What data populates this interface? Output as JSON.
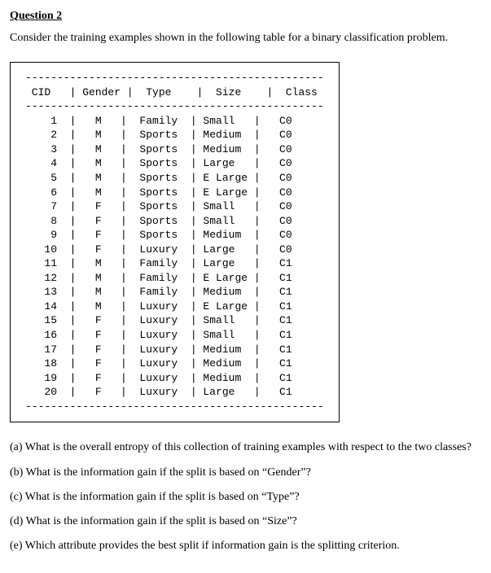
{
  "header": "Question 2",
  "problem": "Consider the training examples shown in the following table for a binary classification problem.",
  "table": {
    "columns": [
      "CID",
      "Gender",
      "Type",
      "Size",
      "Class"
    ],
    "rows": [
      {
        "cid": "1",
        "gender": "M",
        "type": "Family",
        "size": "Small",
        "class": "C0"
      },
      {
        "cid": "2",
        "gender": "M",
        "type": "Sports",
        "size": "Medium",
        "class": "C0"
      },
      {
        "cid": "3",
        "gender": "M",
        "type": "Sports",
        "size": "Medium",
        "class": "C0"
      },
      {
        "cid": "4",
        "gender": "M",
        "type": "Sports",
        "size": "Large",
        "class": "C0"
      },
      {
        "cid": "5",
        "gender": "M",
        "type": "Sports",
        "size": "E Large",
        "class": "C0"
      },
      {
        "cid": "6",
        "gender": "M",
        "type": "Sports",
        "size": "E Large",
        "class": "C0"
      },
      {
        "cid": "7",
        "gender": "F",
        "type": "Sports",
        "size": "Small",
        "class": "C0"
      },
      {
        "cid": "8",
        "gender": "F",
        "type": "Sports",
        "size": "Small",
        "class": "C0"
      },
      {
        "cid": "9",
        "gender": "F",
        "type": "Sports",
        "size": "Medium",
        "class": "C0"
      },
      {
        "cid": "10",
        "gender": "F",
        "type": "Luxury",
        "size": "Large",
        "class": "C0"
      },
      {
        "cid": "11",
        "gender": "M",
        "type": "Family",
        "size": "Large",
        "class": "C1"
      },
      {
        "cid": "12",
        "gender": "M",
        "type": "Family",
        "size": "E Large",
        "class": "C1"
      },
      {
        "cid": "13",
        "gender": "M",
        "type": "Family",
        "size": "Medium",
        "class": "C1"
      },
      {
        "cid": "14",
        "gender": "M",
        "type": "Luxury",
        "size": "E Large",
        "class": "C1"
      },
      {
        "cid": "15",
        "gender": "F",
        "type": "Luxury",
        "size": "Small",
        "class": "C1"
      },
      {
        "cid": "16",
        "gender": "F",
        "type": "Luxury",
        "size": "Small",
        "class": "C1"
      },
      {
        "cid": "17",
        "gender": "F",
        "type": "Luxury",
        "size": "Medium",
        "class": "C1"
      },
      {
        "cid": "18",
        "gender": "F",
        "type": "Luxury",
        "size": "Medium",
        "class": "C1"
      },
      {
        "cid": "19",
        "gender": "F",
        "type": "Luxury",
        "size": "Medium",
        "class": "C1"
      },
      {
        "cid": "20",
        "gender": "F",
        "type": "Luxury",
        "size": "Large",
        "class": "C1"
      }
    ]
  },
  "questions": {
    "a": " (a) What is the overall entropy of this collection of training examples with respect to the two classes?",
    "b": "(b) What is the information gain if the split is based on “Gender”?",
    "c": "(c) What is the information gain if the split is based on “Type”?",
    "d": "(d) What is the information gain if the split is based on “Size”?",
    "e": "(e) Which attribute provides the best split if information gain is the splitting criterion."
  }
}
